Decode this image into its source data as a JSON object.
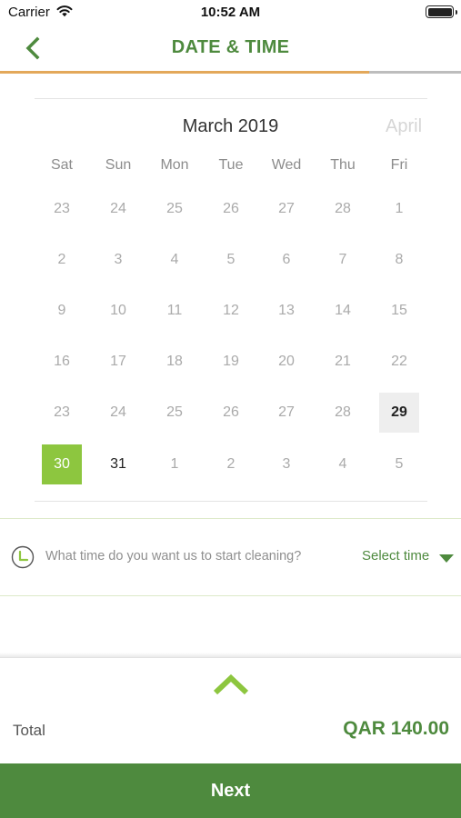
{
  "status_bar": {
    "carrier": "Carrier",
    "time": "10:52 AM",
    "icons": [
      "wifi-icon",
      "battery-icon"
    ]
  },
  "navbar": {
    "title": "DATE & TIME",
    "back_icon": "chevron-left-icon"
  },
  "progress": {
    "fraction": 0.8
  },
  "calendar": {
    "current_month": "March 2019",
    "next_month": "April",
    "weekdays": [
      "Sat",
      "Sun",
      "Mon",
      "Tue",
      "Wed",
      "Thu",
      "Fri"
    ],
    "weeks": [
      [
        "23",
        "24",
        "25",
        "26",
        "27",
        "28",
        "1"
      ],
      [
        "2",
        "3",
        "4",
        "5",
        "6",
        "7",
        "8"
      ],
      [
        "9",
        "10",
        "11",
        "12",
        "13",
        "14",
        "15"
      ],
      [
        "16",
        "17",
        "18",
        "19",
        "20",
        "21",
        "22"
      ],
      [
        "23",
        "24",
        "25",
        "26",
        "27",
        "28",
        "29"
      ],
      [
        "30",
        "31",
        "1",
        "2",
        "3",
        "4",
        "5"
      ]
    ],
    "today": "29",
    "selected": "30",
    "enabled_days": [
      "29",
      "30",
      "31"
    ]
  },
  "time_row": {
    "icon": "clock-icon",
    "question": "What time do you want us to start cleaning?",
    "select_label": "Select time",
    "arrow_icon": "caret-down-icon"
  },
  "summary": {
    "expand_icon": "chevron-up-icon",
    "total_label": "Total",
    "total_value": "QAR 140.00"
  },
  "next_button": {
    "label": "Next"
  },
  "colors": {
    "primary_green": "#4e8a3e",
    "selected_green": "#8dc63f",
    "progress_orange": "#e3a85a"
  }
}
